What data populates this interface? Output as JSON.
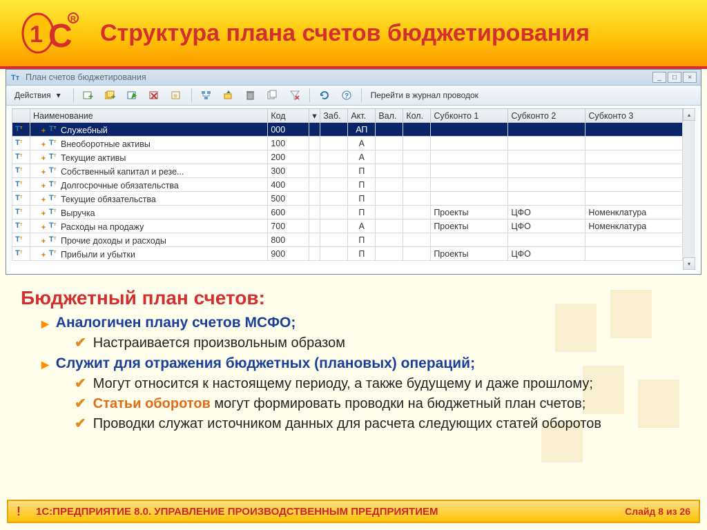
{
  "slide": {
    "title": "Структура плана счетов бюджетирования",
    "footer_product": "1С:ПРЕДПРИЯТИЕ 8.0. УПРАВЛЕНИЕ ПРОИЗВОДСТВЕННЫМ ПРЕДПРИЯТИЕМ",
    "footer_slide": "Слайд 8 из 26"
  },
  "window": {
    "title": "План счетов бюджетирования",
    "actions_label": "Действия",
    "journal_link": "Перейти в журнал проводок"
  },
  "grid": {
    "headers": {
      "name": "Наименование",
      "code": "Код",
      "zab": "Заб.",
      "akt": "Акт.",
      "val": "Вал.",
      "kol": "Кол.",
      "sub1": "Субконто 1",
      "sub2": "Субконто 2",
      "sub3": "Субконто 3"
    },
    "rows": [
      {
        "name": "Служебный",
        "code": "000",
        "akt": "АП",
        "sub1": "",
        "sub2": "",
        "sub3": "",
        "sel": true
      },
      {
        "name": "Внеоборотные активы",
        "code": "100",
        "akt": "А",
        "sub1": "",
        "sub2": "",
        "sub3": ""
      },
      {
        "name": "Текущие активы",
        "code": "200",
        "akt": "А",
        "sub1": "",
        "sub2": "",
        "sub3": ""
      },
      {
        "name": "Собственный капитал и резе...",
        "code": "300",
        "akt": "П",
        "sub1": "",
        "sub2": "",
        "sub3": ""
      },
      {
        "name": "Долгосрочные обязательства",
        "code": "400",
        "akt": "П",
        "sub1": "",
        "sub2": "",
        "sub3": ""
      },
      {
        "name": "Текущие обязательства",
        "code": "500",
        "akt": "П",
        "sub1": "",
        "sub2": "",
        "sub3": ""
      },
      {
        "name": "Выручка",
        "code": "600",
        "akt": "П",
        "sub1": "Проекты",
        "sub2": "ЦФО",
        "sub3": "Номенклатура"
      },
      {
        "name": "Расходы на продажу",
        "code": "700",
        "akt": "А",
        "sub1": "Проекты",
        "sub2": "ЦФО",
        "sub3": "Номенклатура"
      },
      {
        "name": "Прочие доходы и расходы",
        "code": "800",
        "akt": "П",
        "sub1": "",
        "sub2": "",
        "sub3": ""
      },
      {
        "name": "Прибыли и убытки",
        "code": "900",
        "akt": "П",
        "sub1": "Проекты",
        "sub2": "ЦФО",
        "sub3": ""
      }
    ]
  },
  "content": {
    "h2": "Бюджетный план счетов:",
    "b1": "Аналогичен плану счетов МСФО;",
    "b1_1": "Настраивается произвольным образом",
    "b2": "Служит для отражения бюджетных (плановых) операций;",
    "b2_1": "Могут относится к настоящему периоду, а также будущему и даже прошлому;",
    "b2_2a": "Статьи оборотов",
    "b2_2b": " могут формировать проводки на бюджетный план счетов;",
    "b2_3": "Проводки служат источником данных для расчета следующих статей оборотов"
  }
}
